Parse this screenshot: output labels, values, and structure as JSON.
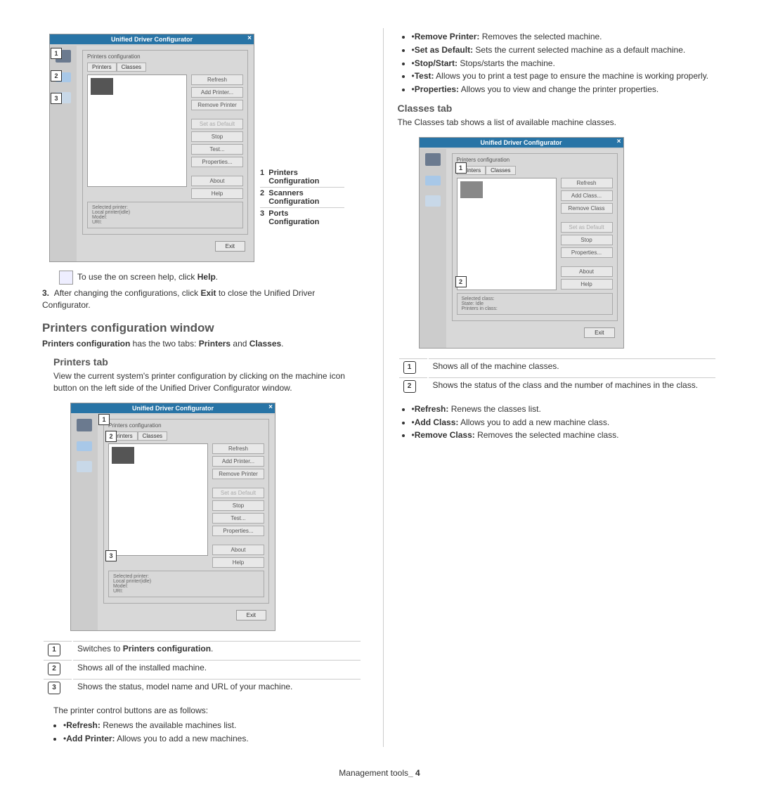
{
  "footer": {
    "label": "Management tools",
    "page": "4"
  },
  "app": {
    "title": "Unified Driver Configurator",
    "fieldset": "Printers configuration",
    "tabs": {
      "printers": "Printers",
      "classes": "Classes"
    }
  },
  "buttons": {
    "refresh": "Refresh",
    "addPrinter": "Add Printer...",
    "removePrinter": "Remove Printer",
    "setDefault": "Set as Default",
    "stop": "Stop",
    "test": "Test...",
    "properties": "Properties...",
    "about": "About",
    "help": "Help",
    "exit": "Exit",
    "addClass": "Add Class...",
    "removeClass": "Remove Class"
  },
  "selPrinter": {
    "title": "Selected printer:",
    "l1": "Local printer(idle)",
    "l2": "Model:",
    "l3": "URI:"
  },
  "selClass": {
    "title": "Selected class:",
    "l1": "State: Idle",
    "l2": "Printers in class:"
  },
  "legendA": {
    "n1": "1",
    "t1a": "Printers",
    "t1b": "Configuration",
    "n2": "2",
    "t2a": "Scanners",
    "t2b": "Configuration",
    "n3": "3",
    "t3a": "Ports",
    "t3b": "Configuration"
  },
  "note": {
    "text": "To use the on screen help, click ",
    "b": "Help",
    "dot": "."
  },
  "step3": {
    "n": "3.",
    "t1": "After changing the configurations, click ",
    "b": "Exit",
    "t2": " to close the Unified Driver Configurator."
  },
  "h1": "Printers configuration window",
  "h1sub": {
    "b1": "Printers configuration",
    "t1": " has the two tabs: ",
    "b2": "Printers",
    "t2": " and ",
    "b3": "Classes",
    "dot": "."
  },
  "h2": "Printers tab",
  "h2p": "View the current system's printer configuration by clicking on the machine icon button on the left side of the Unified Driver Configurator window.",
  "legendB": {
    "r1": {
      "n": "1",
      "t1": "Switches to ",
      "b": "Printers configuration",
      "dot": "."
    },
    "r2": {
      "n": "2",
      "t": "Shows all of the installed machine."
    },
    "r3": {
      "n": "3",
      "t": "Shows the status, model name and URL of your machine."
    }
  },
  "btnIntro": "The printer control buttons are as follows:",
  "bl": {
    "refresh": {
      "b": "Refresh:",
      "t": "  Renews the available machines list."
    },
    "addPrinter": {
      "b": "Add Printer:",
      "t": "  Allows you to add a new machines."
    },
    "removePrinter": {
      "b": "Remove Printer:",
      "t": "  Removes the selected machine."
    },
    "setDefault": {
      "b": "Set as Default:",
      "t": "  Sets the current selected machine as a default machine."
    },
    "stopStart": {
      "b": "Stop/Start:",
      "t": "  Stops/starts the machine."
    },
    "test": {
      "b": "Test:",
      "t": "  Allows you to print a test page to ensure the machine is working properly."
    },
    "properties": {
      "b": "Properties:",
      "t": "  Allows you to view and change the printer properties."
    }
  },
  "h3": "Classes tab",
  "h3p": "The Classes tab shows a list of available machine classes.",
  "legendC": {
    "r1": {
      "n": "1",
      "t": "Shows all of the machine classes."
    },
    "r2": {
      "n": "2",
      "t": "Shows the status of the class and the number of machines in the class."
    }
  },
  "cl": {
    "refresh": {
      "b": "Refresh:",
      "t": "  Renews the classes list."
    },
    "addClass": {
      "b": "Add Class:",
      "t": "  Allows you to add a new machine class."
    },
    "removeClass": {
      "b": "Remove Class:",
      "t": "  Removes the selected machine class."
    }
  }
}
